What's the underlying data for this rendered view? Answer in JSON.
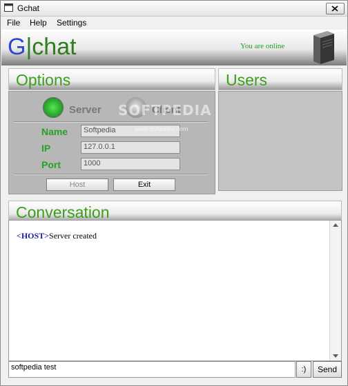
{
  "window": {
    "title": "Gchat"
  },
  "menu": {
    "items": [
      "File",
      "Help",
      "Settings"
    ]
  },
  "header": {
    "logo_g": "G",
    "logo_sep": "|",
    "logo_rest": "chat",
    "status": "You are online"
  },
  "options": {
    "title": "Options",
    "modes": [
      {
        "label": "Server",
        "selected": true
      },
      {
        "label": "Client",
        "selected": false
      }
    ],
    "fields": [
      {
        "label": "Name",
        "value": "Softpedia"
      },
      {
        "label": "IP",
        "value": "127.0.0.1"
      },
      {
        "label": "Port",
        "value": "1000"
      }
    ],
    "buttons": {
      "host": "Host",
      "exit": "Exit"
    },
    "watermark": "SOFTPEDIA",
    "watermark_url": "www.softpedia.com"
  },
  "users": {
    "title": "Users",
    "list": []
  },
  "conversation": {
    "title": "Conversation",
    "messages": [
      {
        "tag": "<HOST>",
        "text": "Server created"
      }
    ],
    "input_value": "softpedia test",
    "emoji_label": ":)",
    "send_label": "Send"
  },
  "colors": {
    "accent_green": "#3c9e1c",
    "label_green": "#25a225",
    "logo_blue": "#3048c8",
    "status_green": "#1aa31a"
  },
  "icons": [
    "window-app-icon",
    "close-icon",
    "server-tower-icon",
    "radio-selected-icon",
    "radio-unselected-icon"
  ]
}
